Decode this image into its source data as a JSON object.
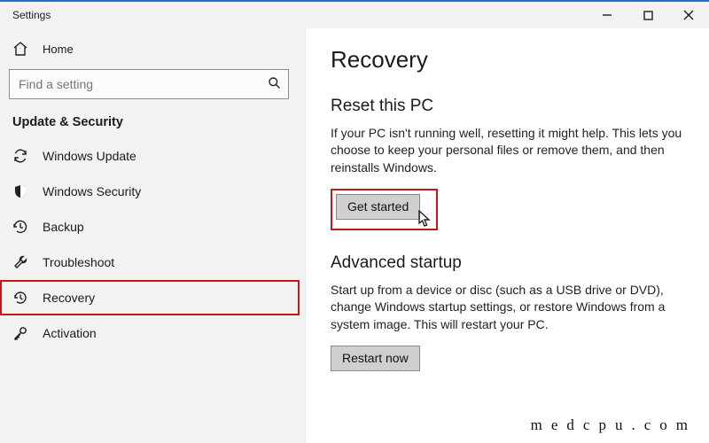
{
  "window": {
    "title": "Settings"
  },
  "sidebar": {
    "home_label": "Home",
    "search_placeholder": "Find a setting",
    "section_header": "Update & Security",
    "items": [
      {
        "icon": "sync-icon",
        "label": "Windows Update"
      },
      {
        "icon": "shield-icon",
        "label": "Windows Security"
      },
      {
        "icon": "backup-icon",
        "label": "Backup"
      },
      {
        "icon": "wrench-icon",
        "label": "Troubleshoot"
      },
      {
        "icon": "history-icon",
        "label": "Recovery"
      },
      {
        "icon": "key-icon",
        "label": "Activation"
      }
    ]
  },
  "page": {
    "title": "Recovery",
    "reset": {
      "heading": "Reset this PC",
      "body": "If your PC isn't running well, resetting it might help. This lets you choose to keep your personal files or remove them, and then reinstalls Windows.",
      "button": "Get started"
    },
    "advanced": {
      "heading": "Advanced startup",
      "body": "Start up from a device or disc (such as a USB drive or DVD), change Windows startup settings, or restore Windows from a system image. This will restart your PC.",
      "button": "Restart now"
    }
  },
  "watermark": "medcpu.com"
}
